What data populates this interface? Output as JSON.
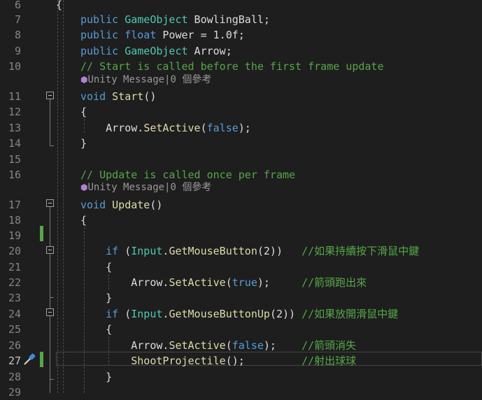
{
  "lines": [
    {
      "n": "6",
      "segs": [
        {
          "t": "{",
          "c": ""
        }
      ],
      "indent": -1
    },
    {
      "n": "7",
      "segs": [
        {
          "t": "public ",
          "c": "kw"
        },
        {
          "t": "GameObject",
          "c": "ty"
        },
        {
          "t": " BowlingBall;",
          "c": ""
        }
      ]
    },
    {
      "n": "8",
      "segs": [
        {
          "t": "public ",
          "c": "kw"
        },
        {
          "t": "float",
          "c": "kw"
        },
        {
          "t": " Power = 1.0f;",
          "c": ""
        }
      ]
    },
    {
      "n": "9",
      "segs": [
        {
          "t": "public ",
          "c": "kw"
        },
        {
          "t": "GameObject",
          "c": "ty"
        },
        {
          "t": " Arrow;",
          "c": ""
        }
      ]
    },
    {
      "n": "10",
      "segs": [
        {
          "t": "// Start is called before the first frame update",
          "c": "cm"
        }
      ]
    },
    {
      "n": "11",
      "segs": [
        {
          "t": "void ",
          "c": "kw"
        },
        {
          "t": "Start",
          "c": "fn"
        },
        {
          "t": "()",
          "c": ""
        }
      ]
    },
    {
      "n": "12",
      "segs": [
        {
          "t": "{",
          "c": ""
        }
      ]
    },
    {
      "n": "13",
      "segs": [
        {
          "t": "    Arrow.",
          "c": ""
        },
        {
          "t": "SetActive",
          "c": "fn"
        },
        {
          "t": "(",
          "c": ""
        },
        {
          "t": "false",
          "c": "kw"
        },
        {
          "t": ");",
          "c": ""
        }
      ]
    },
    {
      "n": "14",
      "segs": [
        {
          "t": "}",
          "c": ""
        }
      ]
    },
    {
      "n": "15",
      "segs": []
    },
    {
      "n": "16",
      "segs": [
        {
          "t": "// Update is called once per frame",
          "c": "cm"
        }
      ]
    },
    {
      "n": "17",
      "segs": [
        {
          "t": "void ",
          "c": "kw"
        },
        {
          "t": "Update",
          "c": "fn"
        },
        {
          "t": "()",
          "c": ""
        }
      ]
    },
    {
      "n": "18",
      "segs": [
        {
          "t": "{",
          "c": ""
        }
      ]
    },
    {
      "n": "19",
      "segs": []
    },
    {
      "n": "20",
      "segs": [
        {
          "t": "    if ",
          "c": "kw"
        },
        {
          "t": "(",
          "c": ""
        },
        {
          "t": "Input",
          "c": "ty"
        },
        {
          "t": ".",
          "c": ""
        },
        {
          "t": "GetMouseButton",
          "c": "fn"
        },
        {
          "t": "(2))   ",
          "c": ""
        },
        {
          "t": "//如果持續按下滑鼠中鍵",
          "c": "cm"
        }
      ]
    },
    {
      "n": "21",
      "segs": [
        {
          "t": "    {",
          "c": ""
        }
      ]
    },
    {
      "n": "22",
      "segs": [
        {
          "t": "        Arrow.",
          "c": ""
        },
        {
          "t": "SetActive",
          "c": "fn"
        },
        {
          "t": "(",
          "c": ""
        },
        {
          "t": "true",
          "c": "kw"
        },
        {
          "t": ");     ",
          "c": ""
        },
        {
          "t": "//箭頭跑出來",
          "c": "cm"
        }
      ]
    },
    {
      "n": "23",
      "segs": [
        {
          "t": "    }",
          "c": ""
        }
      ]
    },
    {
      "n": "24",
      "segs": [
        {
          "t": "    if ",
          "c": "kw"
        },
        {
          "t": "(",
          "c": ""
        },
        {
          "t": "Input",
          "c": "ty"
        },
        {
          "t": ".",
          "c": ""
        },
        {
          "t": "GetMouseButtonUp",
          "c": "fn"
        },
        {
          "t": "(2)) ",
          "c": ""
        },
        {
          "t": "//如果放開滑鼠中鍵",
          "c": "cm"
        }
      ]
    },
    {
      "n": "25",
      "segs": [
        {
          "t": "    {",
          "c": ""
        }
      ]
    },
    {
      "n": "26",
      "segs": [
        {
          "t": "        Arrow.",
          "c": ""
        },
        {
          "t": "SetActive",
          "c": "fn"
        },
        {
          "t": "(",
          "c": ""
        },
        {
          "t": "false",
          "c": "kw"
        },
        {
          "t": ");    ",
          "c": ""
        },
        {
          "t": "//箭頭消失",
          "c": "cm"
        }
      ]
    },
    {
      "n": "27",
      "segs": [
        {
          "t": "        ",
          "c": ""
        },
        {
          "t": "ShootProjectile",
          "c": "fn"
        },
        {
          "t": "();         ",
          "c": ""
        },
        {
          "t": "//射出球球",
          "c": "cm"
        }
      ]
    },
    {
      "n": "28",
      "segs": [
        {
          "t": "    }",
          "c": ""
        }
      ]
    },
    {
      "n": "29",
      "segs": []
    }
  ],
  "codelens": [
    {
      "text": "Unity Message|0 個參考"
    },
    {
      "text": "Unity Message|0 個參考"
    }
  ],
  "current_line": "27",
  "colors": {
    "background": "#1e1e1e",
    "keyword": "#569cd6",
    "type": "#4ec9b0",
    "comment": "#57a64a",
    "method": "#dcdcaa",
    "change_bar": "#57a64a"
  },
  "icons": {
    "codelens_icon": "unity-cube-icon",
    "gutter_icon": "quick-action-screwdriver-icon"
  }
}
